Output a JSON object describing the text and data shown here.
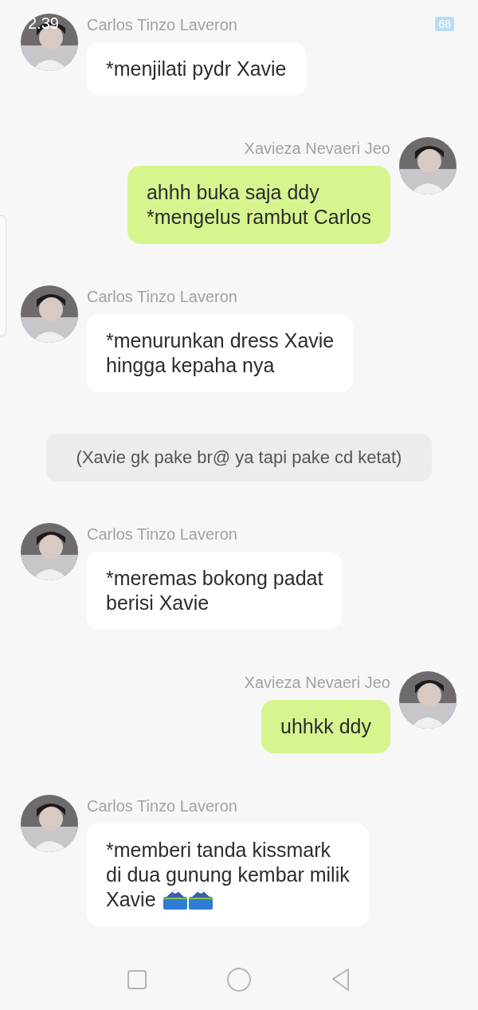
{
  "status_bar": {
    "time": "2.39",
    "battery": "68"
  },
  "messages": [
    {
      "kind": "incoming",
      "sender": "Carlos Tinzo Laveron",
      "text": "*menjilati pydr Xavie",
      "trailing_emoji": false
    },
    {
      "kind": "outgoing",
      "sender": "Xavieza Nevaeri Jeo",
      "text": "ahhh buka saja ddy\n*mengelus rambut Carlos",
      "trailing_emoji": false
    },
    {
      "kind": "incoming",
      "sender": "Carlos Tinzo Laveron",
      "text": "*menurunkan dress Xavie\nhingga kepaha nya",
      "trailing_emoji": false
    },
    {
      "kind": "narration",
      "text": "(Xavie gk pake br@ ya tapi pake cd ketat)"
    },
    {
      "kind": "incoming",
      "sender": "Carlos Tinzo Laveron",
      "text": "*meremas bokong padat\nberisi Xavie",
      "trailing_emoji": false
    },
    {
      "kind": "outgoing",
      "sender": "Xavieza Nevaeri Jeo",
      "text": "uhhkk ddy",
      "trailing_emoji": false
    },
    {
      "kind": "incoming",
      "sender": "Carlos Tinzo Laveron",
      "text": "*memberi tanda kissmark\ndi dua gunung kembar milik\nXavie",
      "trailing_emoji": true
    }
  ]
}
